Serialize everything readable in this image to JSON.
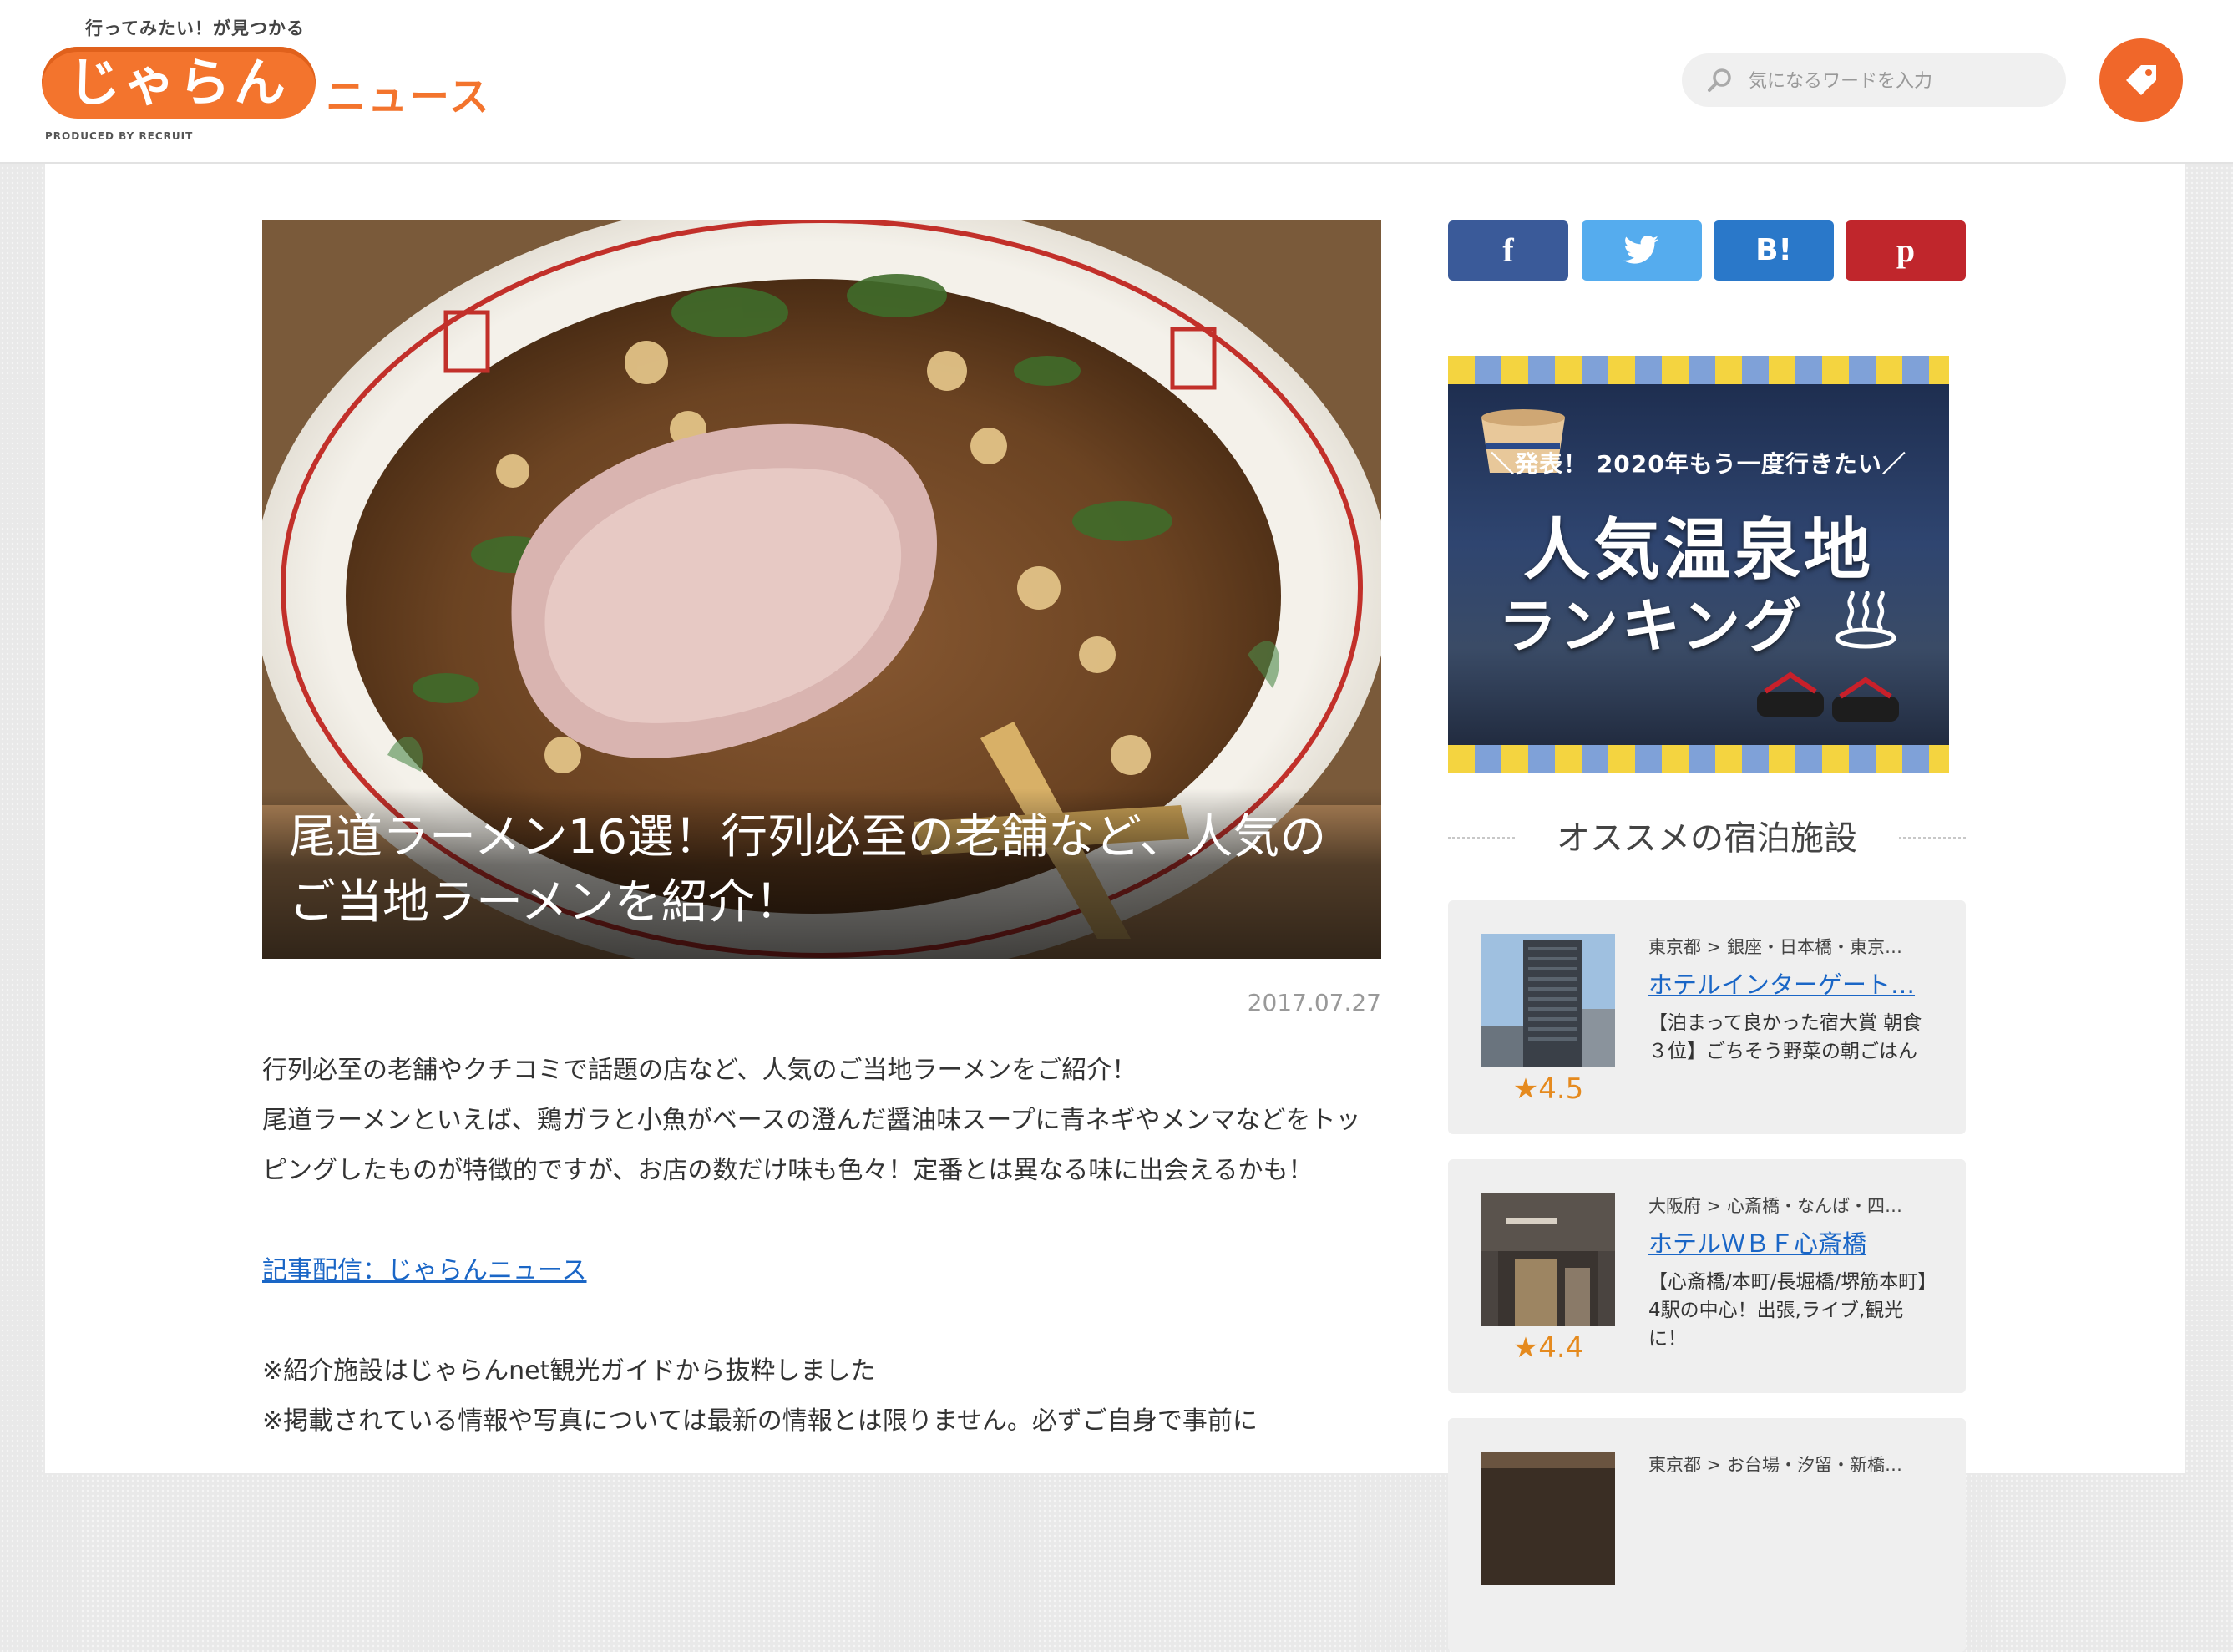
{
  "header": {
    "logo": {
      "tagline": "行ってみたい！が見つかる",
      "main": "じゃらん",
      "sub": "ニュース",
      "produced_by": "PRODUCED BY RECRUIT"
    },
    "search": {
      "placeholder": "気になるワードを入力",
      "icon": "search-icon"
    },
    "tag_button_icon": "tag-icon"
  },
  "article": {
    "title": "尾道ラーメン16選！行列必至の老舗など、人気のご当地ラーメンを紹介！",
    "date": "2017.07.27",
    "lead_1": "行列必至の老舗やクチコミで話題の店など、人気のご当地ラーメンをご紹介！",
    "lead_2": "尾道ラーメンといえば、鶏ガラと小魚がベースの澄んだ醤油味スープに青ネギやメンマなどをトッピングしたものが特徴的ですが、お店の数だけ味も色々！定番とは異なる味に出会えるかも！",
    "source_link": "記事配信：じゃらんニュース",
    "note_1": "※紹介施設はじゃらんnet観光ガイドから抜粋しました",
    "note_2": "※掲載されている情報や写真については最新の情報とは限りません。必ずご自身で事前に"
  },
  "share": {
    "facebook": "f",
    "twitter_icon": "twitter-bird-icon",
    "hatena": "B!",
    "pinterest": "p"
  },
  "banner": {
    "subtitle": "＼発表！ 2020年もう一度行きたい／",
    "main_line1": "人気温泉地",
    "main_line2": "ランキング"
  },
  "sidebar": {
    "section_title": "オススメの宿泊施設",
    "hotels": [
      {
        "area": "東京都 > 銀座・日本橋・東京…",
        "name": "ホテルインターゲート…",
        "desc": "【泊まって良かった宿大賞 朝食３位】ごちそう野菜の朝ごはん",
        "rating": "★4.5"
      },
      {
        "area": "大阪府 > 心斎橋・なんば・四…",
        "name": "ホテルＷＢＦ心斎橋",
        "desc": "【心斎橋/本町/長堀橋/堺筋本町】4駅の中心！出張,ライブ,観光に！",
        "rating": "★4.4"
      },
      {
        "area": "東京都 > お台場・汐留・新橋…",
        "name": "",
        "desc": "",
        "rating": ""
      }
    ]
  },
  "colors": {
    "brand_orange": "#f3742d",
    "link_blue": "#1a66c6",
    "facebook": "#3a5a99",
    "twitter": "#55acee",
    "hatena": "#2a78c9",
    "pinterest": "#c0262c",
    "rating": "#e58a1e"
  }
}
